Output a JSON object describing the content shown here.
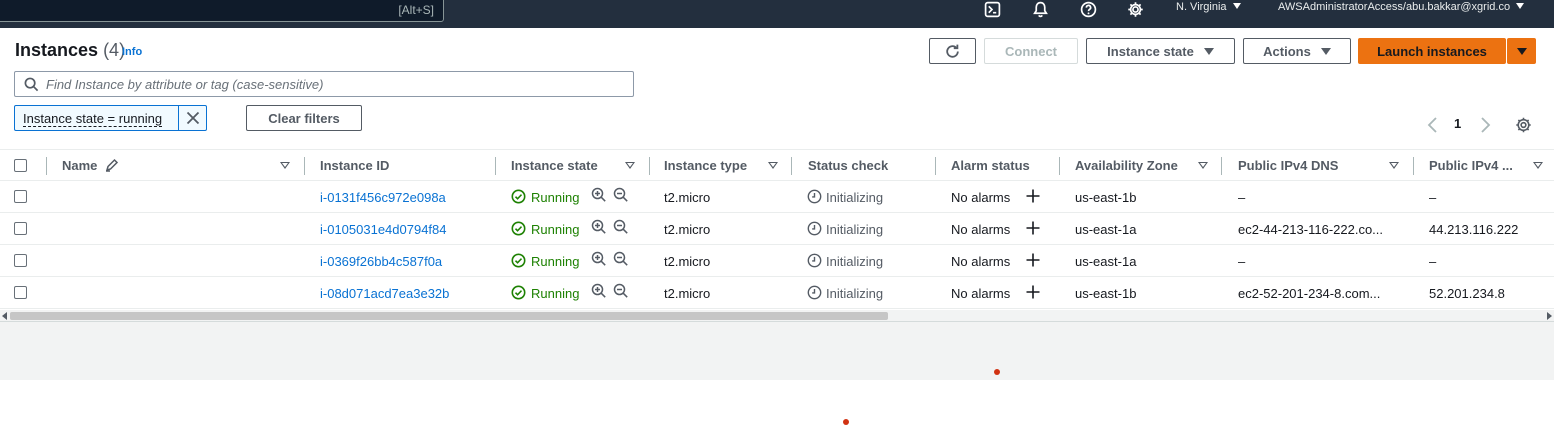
{
  "topnav": {
    "search_shortcut": "[Alt+S]",
    "region": "N. Virginia",
    "account": "AWSAdministratorAccess/abu.bakkar@xgrid.co",
    "icons": [
      "cloudshell-icon",
      "notifications-icon",
      "help-icon",
      "settings-icon"
    ]
  },
  "header": {
    "title": "Instances",
    "count": "(4)",
    "info": "Info"
  },
  "toolbar": {
    "connect": "Connect",
    "instance_state": "Instance state",
    "actions": "Actions",
    "launch": "Launch instances"
  },
  "search": {
    "placeholder": "Find Instance by attribute or tag (case-sensitive)"
  },
  "filter": {
    "token": "Instance state = running",
    "clear": "Clear filters"
  },
  "pagination": {
    "page": "1"
  },
  "table": {
    "columns": [
      "Name",
      "Instance ID",
      "Instance state",
      "Instance type",
      "Status check",
      "Alarm status",
      "Availability Zone",
      "Public IPv4 DNS",
      "Public IPv4 ..."
    ],
    "rows": [
      {
        "name": "",
        "id": "i-0131f456c972e098a",
        "state": "Running",
        "type": "t2.micro",
        "status": "Initializing",
        "alarm": "No alarms",
        "az": "us-east-1b",
        "dns": "–",
        "ip": "–"
      },
      {
        "name": "",
        "id": "i-0105031e4d0794f84",
        "state": "Running",
        "type": "t2.micro",
        "status": "Initializing",
        "alarm": "No alarms",
        "az": "us-east-1a",
        "dns": "ec2-44-213-116-222.co...",
        "ip": "44.213.116.222"
      },
      {
        "name": "",
        "id": "i-0369f26bb4c587f0a",
        "state": "Running",
        "type": "t2.micro",
        "status": "Initializing",
        "alarm": "No alarms",
        "az": "us-east-1a",
        "dns": "–",
        "ip": "–"
      },
      {
        "name": "",
        "id": "i-08d071acd7ea3e32b",
        "state": "Running",
        "type": "t2.micro",
        "status": "Initializing",
        "alarm": "No alarms",
        "az": "us-east-1b",
        "dns": "ec2-52-201-234-8.com...",
        "ip": "52.201.234.8"
      }
    ]
  },
  "colors": {
    "nav_bg": "#232f3e",
    "link": "#0972d3",
    "running": "#1d8102",
    "primary": "#ec7211"
  }
}
